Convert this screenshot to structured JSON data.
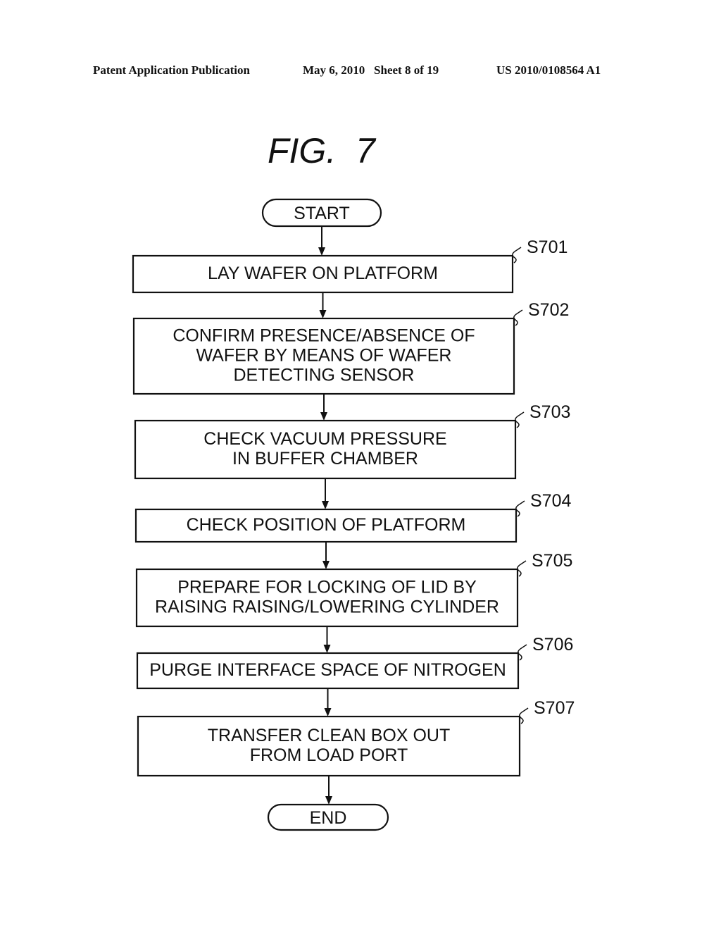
{
  "header": {
    "publication": "Patent Application Publication",
    "date_sheet": "May 6, 2010   Sheet 8 of 19",
    "number": "US 2010/0108564 A1"
  },
  "figure": {
    "title": "FIG.  7"
  },
  "flowchart": {
    "start": "START",
    "end": "END",
    "steps": [
      {
        "id": "S701",
        "lines": [
          "LAY WAFER ON PLATFORM"
        ]
      },
      {
        "id": "S702",
        "lines": [
          "CONFIRM PRESENCE/ABSENCE OF",
          "WAFER BY MEANS OF WAFER",
          "DETECTING SENSOR"
        ]
      },
      {
        "id": "S703",
        "lines": [
          "CHECK VACUUM PRESSURE",
          "IN BUFFER CHAMBER"
        ]
      },
      {
        "id": "S704",
        "lines": [
          "CHECK POSITION OF PLATFORM"
        ]
      },
      {
        "id": "S705",
        "lines": [
          "PREPARE FOR LOCKING OF LID BY",
          "RAISING RAISING/LOWERING CYLINDER"
        ]
      },
      {
        "id": "S706",
        "lines": [
          "PURGE INTERFACE SPACE OF NITROGEN"
        ]
      },
      {
        "id": "S707",
        "lines": [
          "TRANSFER CLEAN BOX OUT",
          "FROM LOAD PORT"
        ]
      }
    ]
  }
}
